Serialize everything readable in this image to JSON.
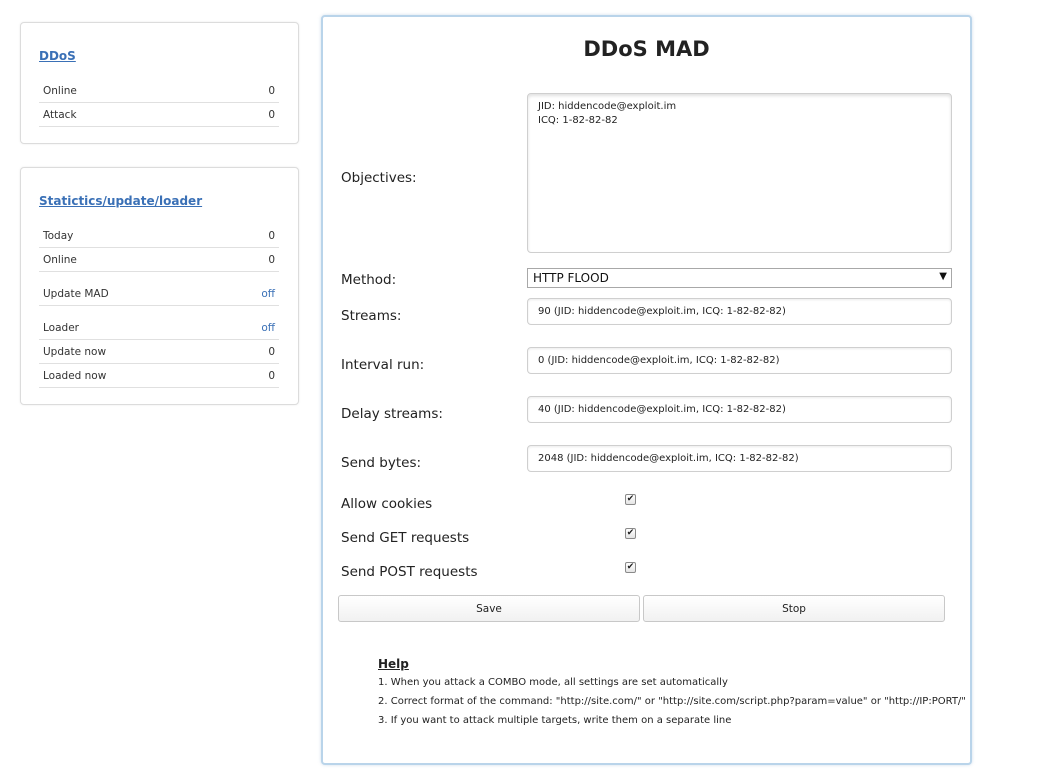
{
  "sidebar": {
    "ddos": {
      "title": "DDoS",
      "rows": [
        {
          "label": "Online",
          "value": "0"
        },
        {
          "label": "Attack",
          "value": "0"
        }
      ]
    },
    "stats": {
      "title": "Statictics/update/loader",
      "rows": [
        {
          "label": "Today",
          "value": "0"
        },
        {
          "label": "Online",
          "value": "0"
        },
        {
          "label": "Update MAD",
          "value": "off"
        },
        {
          "label": "Loader",
          "value": "off"
        },
        {
          "label": "Update now",
          "value": "0"
        },
        {
          "label": "Loaded now",
          "value": "0"
        }
      ]
    }
  },
  "main": {
    "title": "DDoS MAD",
    "objectives": {
      "label": "Objectives:",
      "value": "JID: hiddencode@exploit.im\nICQ: 1-82-82-82"
    },
    "method": {
      "label": "Method:",
      "value": "HTTP FLOOD"
    },
    "streams": {
      "label": "Streams:",
      "value": "90 (JID: hiddencode@exploit.im, ICQ: 1-82-82-82)"
    },
    "interval_run": {
      "label": "Interval run:",
      "value": "0 (JID: hiddencode@exploit.im, ICQ: 1-82-82-82)"
    },
    "delay_streams": {
      "label": "Delay streams:",
      "value": "40 (JID: hiddencode@exploit.im, ICQ: 1-82-82-82)"
    },
    "send_bytes": {
      "label": "Send bytes:",
      "value": "2048 (JID: hiddencode@exploit.im, ICQ: 1-82-82-82)"
    },
    "checkboxes": [
      {
        "label": "Allow cookies",
        "checked": true,
        "mark": "✔"
      },
      {
        "label": "Send GET requests",
        "checked": true,
        "mark": "✔"
      },
      {
        "label": "Send POST requests",
        "checked": true,
        "mark": "✔"
      }
    ],
    "save_label": "Save",
    "stop_label": "Stop",
    "help": {
      "title": "Help",
      "lines": [
        "1. When you attack a COMBO mode, all settings are set automatically",
        "2. Correct format of the command: \"http://site.com/\" or \"http://site.com/script.php?param=value\" or \"http://IP:PORT/\"",
        "3. If you want to attack multiple targets, write them on a separate line"
      ]
    }
  },
  "colors": {
    "link": "#3a70b6",
    "main_border": "#b9d4ea"
  },
  "icons": {
    "select_arrow": "▼"
  }
}
